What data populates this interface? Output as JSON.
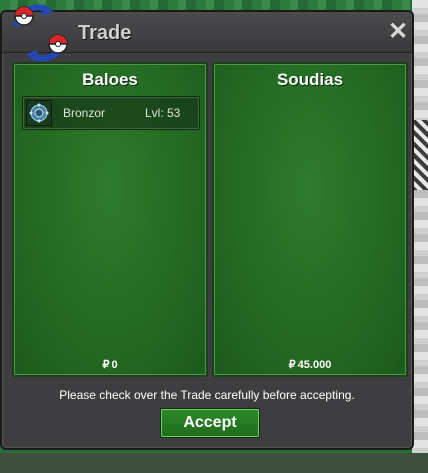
{
  "window": {
    "title": "Trade",
    "close_symbol": "✕"
  },
  "trade": {
    "left": {
      "name": "Baloes",
      "pokemon": [
        {
          "name": "Bronzor",
          "level": "Lvl: 53",
          "icon": "bronzor-icon"
        }
      ],
      "currency_symbol": "₽",
      "money": "0"
    },
    "right": {
      "name": "Soudias",
      "pokemon": [],
      "currency_symbol": "₽",
      "money": "45.000"
    }
  },
  "footer": {
    "notice": "Please check over the Trade carefully before accepting.",
    "accept_label": "Accept"
  },
  "colors": {
    "panel_green": "#246a23",
    "window_gray": "#3e3e40",
    "button_green": "#2e8a2a"
  }
}
